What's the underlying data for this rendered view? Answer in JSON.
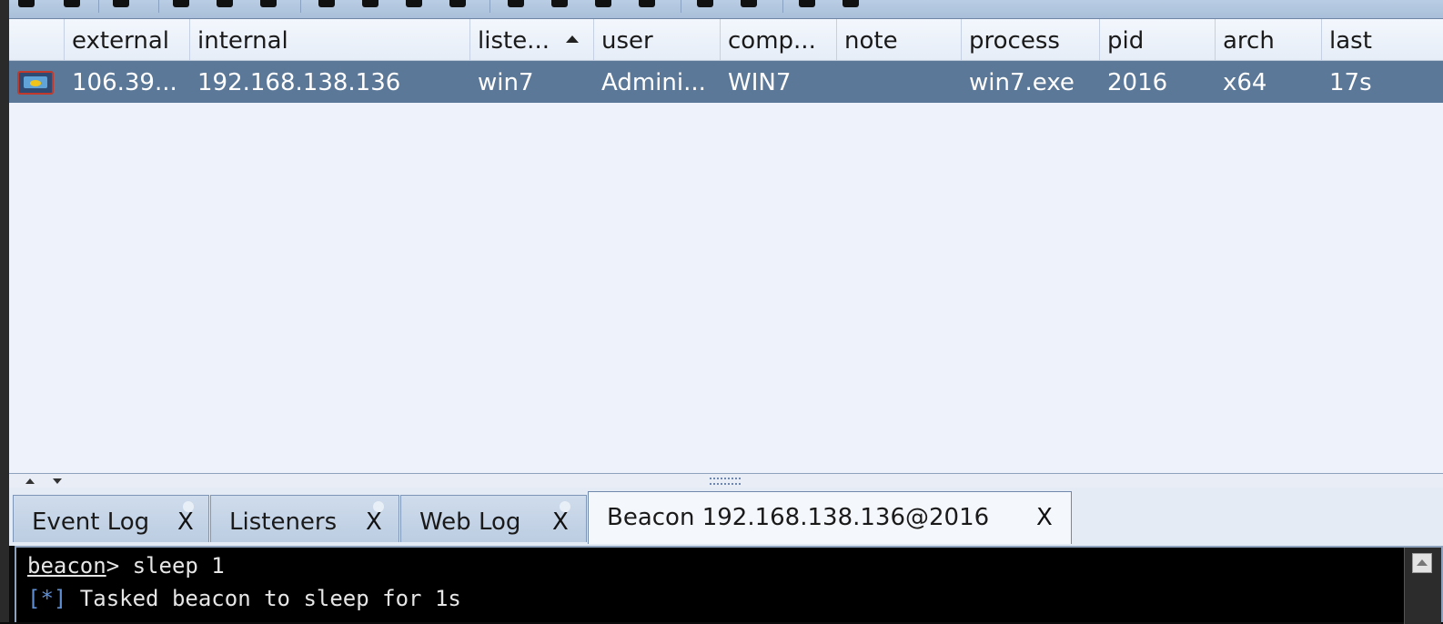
{
  "table": {
    "columns": [
      "",
      "external",
      "internal",
      "liste...",
      "user",
      "comp...",
      "note",
      "process",
      "pid",
      "arch",
      "last"
    ],
    "sorted_column": "liste...",
    "rows": [
      {
        "icon": "computer-beacon-icon",
        "external": "106.39...",
        "internal": "192.168.138.136",
        "listener": "win7",
        "user": "Admini...",
        "computer": "WIN7",
        "note": "",
        "process": "win7.exe",
        "pid": "2016",
        "arch": "x64",
        "last": "17s"
      }
    ]
  },
  "tabs": [
    {
      "label": "Event Log",
      "close": "X"
    },
    {
      "label": "Listeners",
      "close": "X"
    },
    {
      "label": "Web Log",
      "close": "X"
    },
    {
      "label": "Beacon 192.168.138.136@2016",
      "close": "X",
      "active": true
    }
  ],
  "console": {
    "prompt": "beacon",
    "prompt_sep": "> ",
    "command": "sleep 1",
    "output_marker": "[*]",
    "output_text": " Tasked beacon to sleep for 1s"
  },
  "colors": {
    "selected_row": "#5b7898",
    "table_bg": "#eef3fb",
    "console_bg": "#000000",
    "marker": "#5e8fd4"
  }
}
